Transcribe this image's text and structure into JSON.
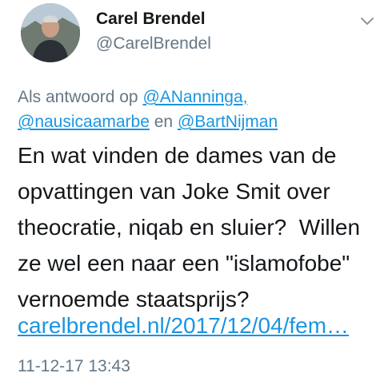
{
  "author": {
    "display_name": "Carel Brendel",
    "handle": "@CarelBrendel",
    "avatar_icon": "profile-photo"
  },
  "reply": {
    "prefix": "Als antwoord op",
    "mention_1": "@ANanninga,",
    "mention_2": "@nausicaamarbe",
    "conjunction": "en",
    "mention_3": "@BartNijman"
  },
  "tweet": {
    "lines": [
      "En wat vinden de dames van de",
      "opvattingen van Joke Smit over",
      "theocratie, niqab en sluier?  Willen",
      "ze wel een naar een \"islamofobe\"",
      "vernoemde staatsprijs?"
    ],
    "link": "carelbrendel.nl/2017/12/04/fem…"
  },
  "timestamp": "11-12-17 13:43",
  "menu_icon": "chevron-down-icon",
  "colors": {
    "link": "#1b95e0",
    "secondary_text": "#657786",
    "primary_text": "#14171a"
  }
}
